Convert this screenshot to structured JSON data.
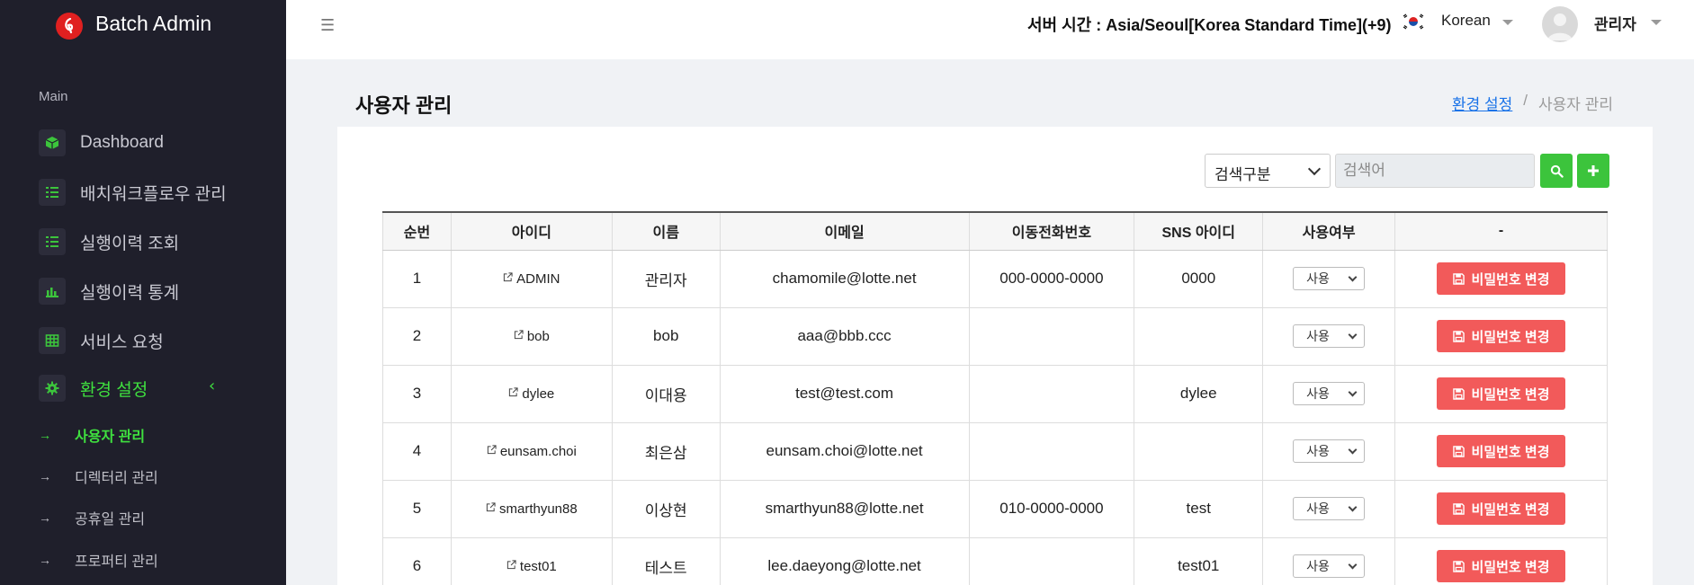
{
  "app": {
    "brand": "Batch Admin"
  },
  "sidebar": {
    "section_label": "Main",
    "items": [
      {
        "label": "Dashboard",
        "icon": "cube-icon"
      },
      {
        "label": "배치워크플로우 관리",
        "icon": "list-icon"
      },
      {
        "label": "실행이력 조회",
        "icon": "list-icon"
      },
      {
        "label": "실행이력 통계",
        "icon": "bar-chart-icon"
      },
      {
        "label": "서비스 요청",
        "icon": "table-icon"
      },
      {
        "label": "환경 설정",
        "icon": "gear-icon",
        "active": true
      }
    ],
    "sub_items": [
      {
        "label": "사용자 관리",
        "active": true
      },
      {
        "label": "디렉터리 관리"
      },
      {
        "label": "공휴일 관리"
      },
      {
        "label": "프로퍼티 관리"
      }
    ]
  },
  "topbar": {
    "server_time": "서버 시간 : Asia/Seoul[Korea Standard Time](+9)",
    "language": "Korean",
    "user": "관리자"
  },
  "page": {
    "title": "사용자 관리",
    "breadcrumb": {
      "parent": "환경 설정",
      "separator": "/",
      "current": "사용자 관리"
    }
  },
  "search": {
    "type_label": "검색구분",
    "placeholder": "검색어"
  },
  "table": {
    "headers": [
      "순번",
      "아이디",
      "이름",
      "이메일",
      "이동전화번호",
      "SNS 아이디",
      "사용여부",
      "-"
    ],
    "rows": [
      {
        "no": "1",
        "id": "ADMIN",
        "name": "관리자",
        "email": "chamomile@lotte.net",
        "phone": "000-0000-0000",
        "sns": "0000",
        "use": "사용"
      },
      {
        "no": "2",
        "id": "bob",
        "name": "bob",
        "email": "aaa@bbb.ccc",
        "phone": "",
        "sns": "",
        "use": "사용"
      },
      {
        "no": "3",
        "id": "dylee",
        "name": "이대용",
        "email": "test@test.com",
        "phone": "",
        "sns": "dylee",
        "use": "사용"
      },
      {
        "no": "4",
        "id": "eunsam.choi",
        "name": "최은삼",
        "email": "eunsam.choi@lotte.net",
        "phone": "",
        "sns": "",
        "use": "사용"
      },
      {
        "no": "5",
        "id": "smarthyun88",
        "name": "이상현",
        "email": "smarthyun88@lotte.net",
        "phone": "010-0000-0000",
        "sns": "test",
        "use": "사용"
      },
      {
        "no": "6",
        "id": "test01",
        "name": "테스트",
        "email": "lee.daeyong@lotte.net",
        "phone": "",
        "sns": "test01",
        "use": "사용"
      }
    ],
    "password_button": "비밀번호 변경"
  },
  "colors": {
    "accent": "#3fe03f",
    "danger": "#f25a5a",
    "sidebar_bg": "#1f1f2b",
    "brand_red": "#e02020"
  }
}
